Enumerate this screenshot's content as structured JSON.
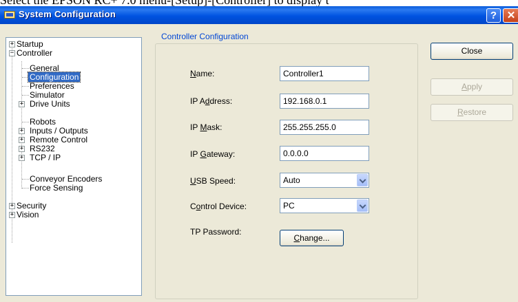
{
  "caption_text": "Select the EPSON RC+ 7.0 menu-[Setup]-[Controller] to display t",
  "window": {
    "title": "System Configuration",
    "help_glyph": "?",
    "close_glyph": "✕"
  },
  "tree": {
    "items": [
      {
        "label": "Startup",
        "expander": "+"
      },
      {
        "label": "Controller",
        "expander": "−"
      },
      {
        "label": "General"
      },
      {
        "label": "Configuration",
        "selected": true
      },
      {
        "label": "Preferences"
      },
      {
        "label": "Simulator"
      },
      {
        "label": "Drive Units",
        "expander": "+"
      },
      {
        "label": "Robots"
      },
      {
        "label": "Inputs / Outputs",
        "expander": "+"
      },
      {
        "label": "Remote Control",
        "expander": "+"
      },
      {
        "label": "RS232",
        "expander": "+"
      },
      {
        "label": "TCP / IP",
        "expander": "+"
      },
      {
        "label": "Conveyor Encoders"
      },
      {
        "label": "Force Sensing"
      },
      {
        "label": "Security",
        "expander": "+"
      },
      {
        "label": "Vision",
        "expander": "+"
      }
    ]
  },
  "group": {
    "caption": "Controller Configuration",
    "fields": {
      "name": {
        "label_pre": "",
        "label_key": "N",
        "label_post": "ame:",
        "value": "Controller1"
      },
      "ip_address": {
        "label_pre": "IP A",
        "label_key": "d",
        "label_post": "dress:",
        "value": "192.168.0.1"
      },
      "ip_mask": {
        "label_pre": "IP ",
        "label_key": "M",
        "label_post": "ask:",
        "value": "255.255.255.0"
      },
      "ip_gateway": {
        "label_pre": "IP ",
        "label_key": "G",
        "label_post": "ateway:",
        "value": "0.0.0.0"
      },
      "usb_speed": {
        "label_pre": "",
        "label_key": "U",
        "label_post": "SB Speed:",
        "value": "Auto"
      },
      "control_device": {
        "label_pre": "C",
        "label_key": "o",
        "label_post": "ntrol Device:",
        "value": "PC"
      },
      "tp_password": {
        "label": "TP Password:",
        "button_key": "C",
        "button_rest": "hange..."
      }
    }
  },
  "buttons": {
    "close": "Close",
    "apply_key": "A",
    "apply_rest": "pply",
    "restore_key": "R",
    "restore_rest": "estore"
  },
  "colors": {
    "title_bar": "#0054e3",
    "selection": "#316ac5",
    "dialog_bg": "#ece9d8",
    "group_caption": "#0046d5"
  }
}
